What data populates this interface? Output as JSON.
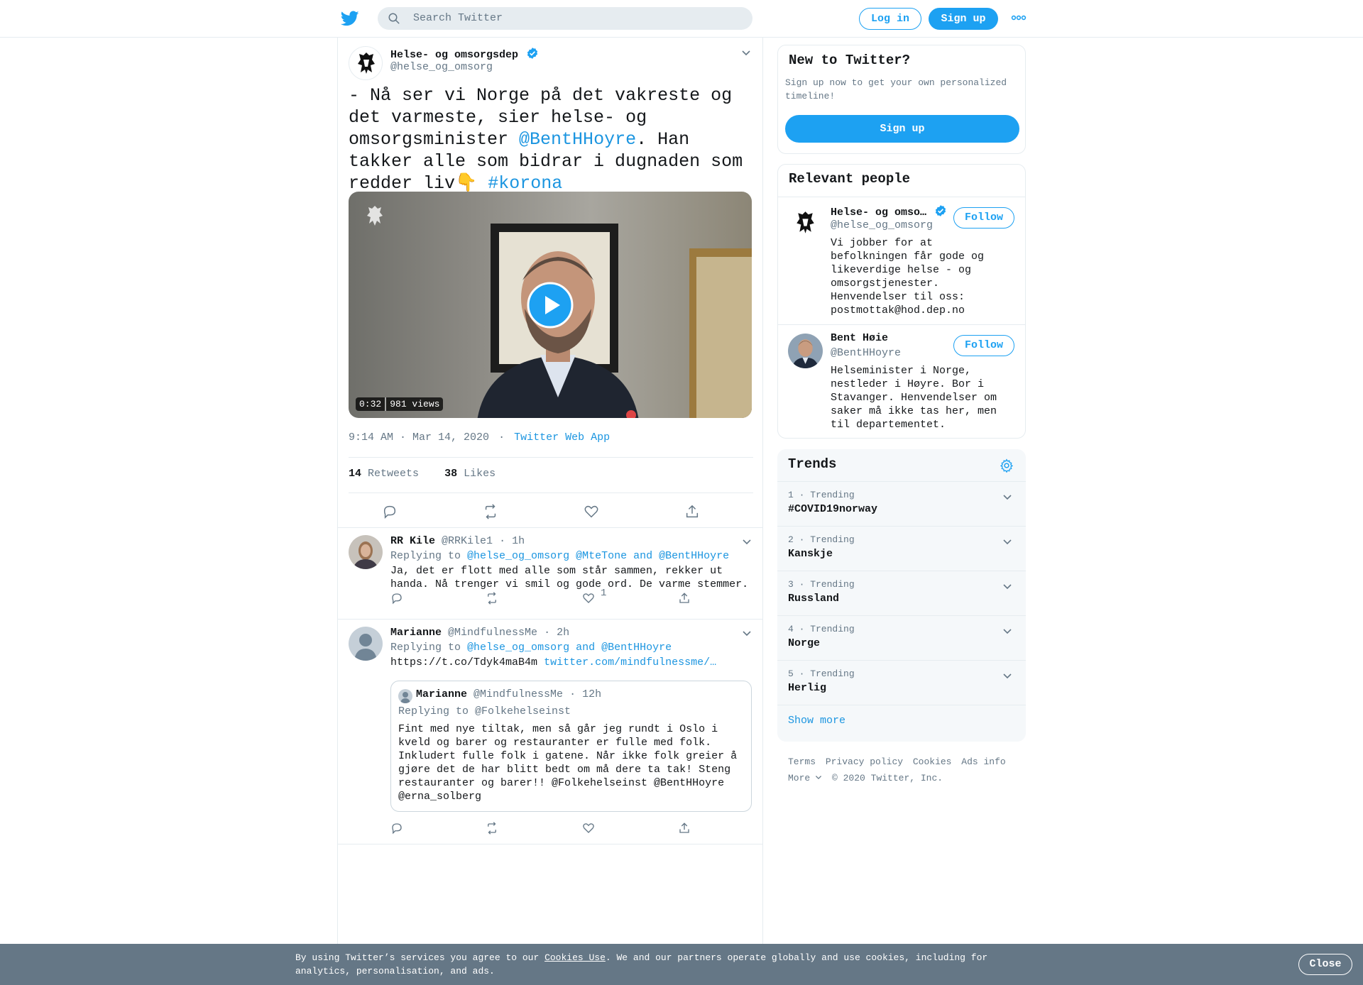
{
  "colors": {
    "accent": "#1da1f2",
    "link": "#1b95e0",
    "muted": "#657786",
    "banner": "#657786"
  },
  "topbar": {
    "search_placeholder": "Search Twitter",
    "login_label": "Log in",
    "signup_label": "Sign up"
  },
  "tweet": {
    "author_name": "Helse- og omsorgsdep",
    "author_handle": "@helse_og_omsorg",
    "text_1": "- Nå ser vi Norge på det vakreste og det varmeste, sier helse- og omsorgsminister ",
    "mention": "@BentHHoyre",
    "text_2": ". Han takker alle som bidrar i dugnaden som redder liv",
    "emoji": "👇",
    "hashtag": "#korona",
    "video_duration": "0:32",
    "video_views": "981 views",
    "time": "9:14 AM · Mar 14, 2020",
    "dot": "·",
    "source": "Twitter Web App",
    "retweets_count": "14",
    "retweets_label": "Retweets",
    "likes_count": "38",
    "likes_label": "Likes"
  },
  "replies": [
    {
      "name": "RR Kile",
      "handle": "@RRKile1",
      "time": "· 1h",
      "replying_prefix": "Replying to",
      "replying_to": "@helse_og_omsorg @MteTone and @BentHHoyre",
      "text": "Ja, det er flott med alle som står sammen, rekker ut handa. Nå trenger vi smil og gode ord. De varme stemmer.",
      "likes": "1"
    },
    {
      "name": "Marianne",
      "handle": "@MindfulnessMe",
      "time": "· 2h",
      "replying_prefix": "Replying to",
      "replying_to": "@helse_og_omsorg and @BentHHoyre",
      "text": "https://t.co/Tdyk4maB4m",
      "link": "twitter.com/mindfulnessme/…",
      "quote": {
        "name": "Marianne",
        "handle": "@MindfulnessMe",
        "time": "· 12h",
        "replying": "Replying to @Folkehelseinst",
        "text": "Fint med nye tiltak, men så går jeg rundt i Oslo i kveld og barer og restauranter er fulle med folk. Inkludert fulle folk i gatene. Når ikke folk greier å gjøre det de har blitt bedt om må dere ta tak! Steng restauranter og barer!! @Folkehelseinst @BentHHoyre @erna_solberg"
      }
    }
  ],
  "sidebar": {
    "new_title": "New to Twitter?",
    "new_text": "Sign up now to get your own personalized timeline!",
    "new_signup": "Sign up",
    "people_title": "Relevant people",
    "follow_label": "Follow",
    "people": [
      {
        "name": "Helse- og omso…",
        "handle": "@helse_og_omsorg",
        "bio": "Vi jobber for at befolkningen får gode og likeverdige helse - og omsorgstjenester. Henvendelser til oss: postmottak@hod.dep.no"
      },
      {
        "name": "Bent Høie",
        "handle": "@BentHHoyre",
        "bio": "Helseminister i Norge, nestleder i Høyre. Bor i Stavanger. Henvendelser om saker må ikke tas her, men til departementet."
      }
    ],
    "trends_title": "Trends",
    "trends": [
      {
        "meta": "1 · Trending",
        "name": "#COVID19norway"
      },
      {
        "meta": "2 · Trending",
        "name": "Kanskje"
      },
      {
        "meta": "3 · Trending",
        "name": "Russland"
      },
      {
        "meta": "4 · Trending",
        "name": "Norge"
      },
      {
        "meta": "5 · Trending",
        "name": "Herlig"
      }
    ],
    "show_more": "Show more",
    "footer": {
      "terms": "Terms",
      "privacy": "Privacy policy",
      "cookies": "Cookies",
      "ads": "Ads info",
      "more": "More",
      "copyright": "© 2020 Twitter, Inc."
    }
  },
  "cookie_banner": {
    "text_1": "By using Twitter’s services you agree to our ",
    "link": "Cookies Use",
    "text_2": ". We and our partners operate globally and use cookies, including for analytics, personalisation, and ads.",
    "close": "Close"
  }
}
